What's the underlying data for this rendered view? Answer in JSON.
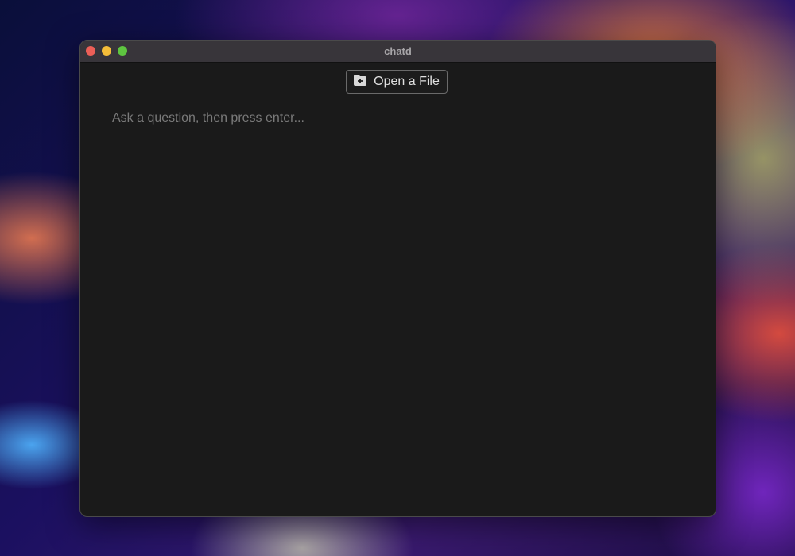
{
  "window": {
    "title": "chatd"
  },
  "toolbar": {
    "open_file_label": "Open a File",
    "open_file_icon": "folder-plus-icon"
  },
  "input": {
    "value": "",
    "placeholder": "Ask a question, then press enter..."
  }
}
